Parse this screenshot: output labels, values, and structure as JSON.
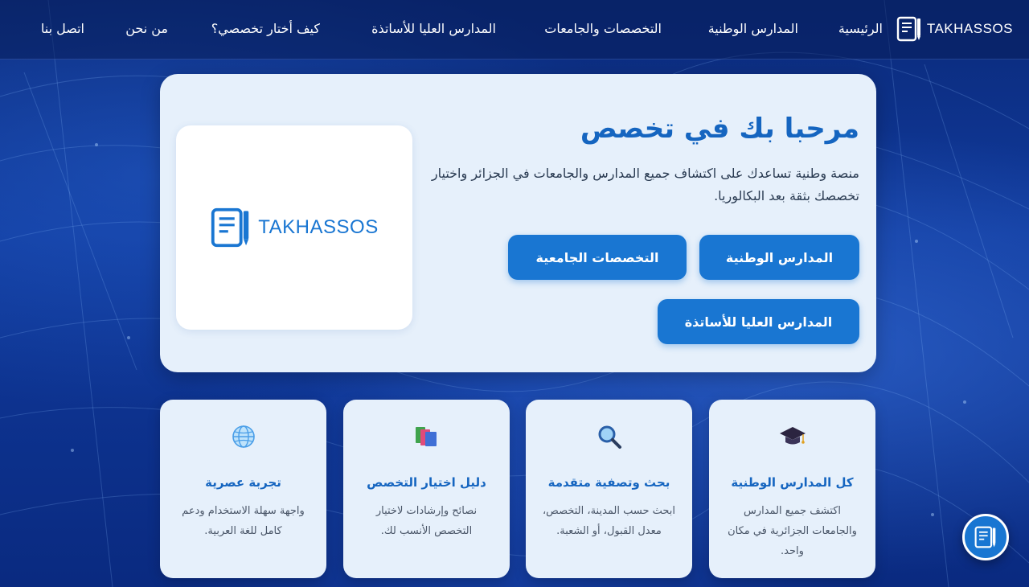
{
  "brand": {
    "name": "TAKHASSOS"
  },
  "nav": {
    "items": [
      {
        "label": "الرئيسية"
      },
      {
        "label": "المدارس الوطنية"
      },
      {
        "label": "التخصصات والجامعات"
      },
      {
        "label": "المدارس العليا للأساتذة"
      },
      {
        "label": "كيف أختار تخصصي؟"
      },
      {
        "label": "من نحن"
      },
      {
        "label": "اتصل بنا"
      }
    ]
  },
  "hero": {
    "title": "مرحبا بك في تخصص",
    "description": "منصة وطنية تساعدك على اكتشاف جميع المدارس والجامعات في الجزائر واختيار تخصصك بثقة بعد البكالوريا.",
    "logo_text": "TAKHASSOS",
    "buttons": [
      {
        "label": "المدارس الوطنية"
      },
      {
        "label": "التخصصات الجامعية"
      },
      {
        "label": "المدارس العليا للأساتذة"
      }
    ]
  },
  "features": [
    {
      "icon": "graduation-cap-icon",
      "title": "كل المدارس الوطنية",
      "description": "اكتشف جميع المدارس والجامعات الجزائرية في مكان واحد."
    },
    {
      "icon": "magnifier-icon",
      "title": "بحث وتصفية متقدمة",
      "description": "ابحث حسب المدينة، التخصص، معدل القبول، أو الشعبة."
    },
    {
      "icon": "books-icon",
      "title": "دليل اختيار التخصص",
      "description": "نصائح وإرشادات لاختيار التخصص الأنسب لك."
    },
    {
      "icon": "globe-icon",
      "title": "تجربة عصرية",
      "description": "واجهة سهلة الاستخدام ودعم كامل للغة العربية."
    }
  ],
  "colors": {
    "primary": "#1976d2",
    "title": "#1565c0",
    "card": "#e6f0fb",
    "background": "#0b2a7a"
  }
}
